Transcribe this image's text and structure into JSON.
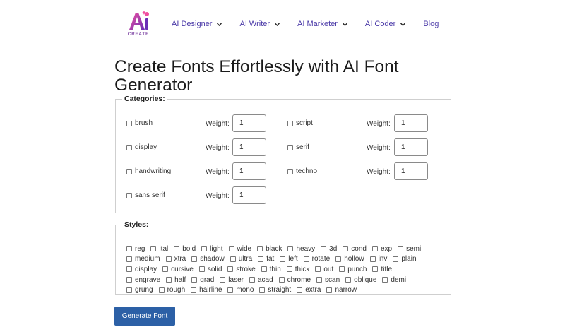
{
  "brand": {
    "logo_text": "CREATE",
    "logo_letters": "Ai"
  },
  "nav": [
    {
      "label": "AI Designer",
      "dropdown": true
    },
    {
      "label": "AI Writer",
      "dropdown": true
    },
    {
      "label": "AI Marketer",
      "dropdown": true
    },
    {
      "label": "AI Coder",
      "dropdown": true
    },
    {
      "label": "Blog",
      "dropdown": false
    }
  ],
  "page_title": "Create Fonts Effortlessly with AI Font Generator",
  "categories": {
    "legend": "Categories:",
    "weight_label": "Weight:",
    "items": [
      {
        "label": "brush",
        "weight": "1",
        "checked": false
      },
      {
        "label": "display",
        "weight": "1",
        "checked": false
      },
      {
        "label": "handwriting",
        "weight": "1",
        "checked": false
      },
      {
        "label": "sans serif",
        "weight": "1",
        "checked": false
      },
      {
        "label": "script",
        "weight": "1",
        "checked": false
      },
      {
        "label": "serif",
        "weight": "1",
        "checked": false
      },
      {
        "label": "techno",
        "weight": "1",
        "checked": false
      }
    ]
  },
  "styles": {
    "legend": "Styles:",
    "rows": [
      [
        "reg",
        "ital",
        "bold",
        "light",
        "wide",
        "black",
        "heavy",
        "3d",
        "cond",
        "exp",
        "semi"
      ],
      [
        "medium",
        "xtra",
        "shadow",
        "ultra",
        "fat",
        "left",
        "rotate",
        "hollow",
        "inv",
        "plain"
      ],
      [
        "display",
        "cursive",
        "solid",
        "stroke",
        "thin",
        "thick",
        "out",
        "punch",
        "title"
      ],
      [
        "engrave",
        "half",
        "grad",
        "laser",
        "acad",
        "chrome",
        "scan",
        "oblique",
        "demi"
      ],
      [
        "grung",
        "rough",
        "hairline",
        "mono",
        "straight",
        "extra",
        "narrow"
      ]
    ]
  },
  "generate_button": "Generate Font",
  "colors": {
    "nav_text": "#4b3aa8",
    "button_bg": "#2c60a6",
    "logo_pink": "#e0338f",
    "logo_purple": "#7a3fa1"
  }
}
